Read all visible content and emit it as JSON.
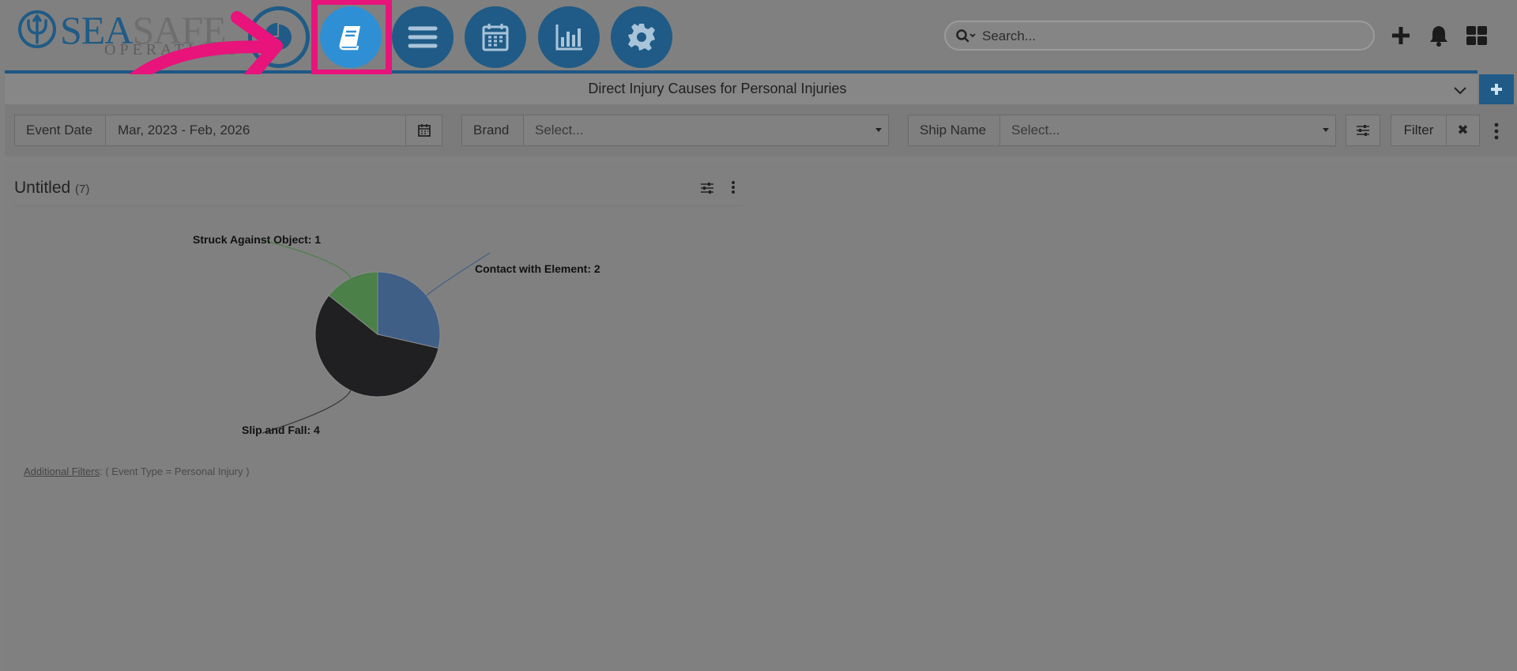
{
  "brand": {
    "logo_primary": "SEA",
    "logo_secondary": "SAFE",
    "logo_sub": "OPERATIONS",
    "accent": "#1f5b86",
    "highlight": "#e8137b"
  },
  "nav": {
    "items": [
      {
        "name": "dashboard",
        "icon": "pie-chart-icon"
      },
      {
        "name": "book",
        "icon": "book-icon",
        "active": true
      },
      {
        "name": "list",
        "icon": "list-icon"
      },
      {
        "name": "calendar",
        "icon": "calendar-icon"
      },
      {
        "name": "reports",
        "icon": "bar-chart-icon"
      },
      {
        "name": "settings",
        "icon": "gear-icon"
      }
    ]
  },
  "search": {
    "placeholder": "Search..."
  },
  "header_icons": [
    "plus-icon",
    "bell-icon",
    "grid-icon"
  ],
  "dashboard": {
    "title": "Direct Injury Causes for Personal Injuries"
  },
  "filters": {
    "event_date": {
      "label": "Event Date",
      "value": "Mar, 2023 - Feb, 2026"
    },
    "brand": {
      "label": "Brand",
      "placeholder": "Select..."
    },
    "ship_name": {
      "label": "Ship Name",
      "placeholder": "Select..."
    },
    "filter_button": "Filter",
    "clear_button": "✖"
  },
  "widget": {
    "title": "Untitled",
    "count": "(7)",
    "additional_filters_label": "Additional Filters",
    "additional_filters_value": ": ( Event Type = Personal Injury )"
  },
  "chart_data": {
    "type": "pie",
    "slices": [
      {
        "label": "Contact with Element",
        "value": 2,
        "color": "#3f5f87",
        "text": "Contact with Element: 2"
      },
      {
        "label": "Slip and Fall",
        "value": 4,
        "color": "#202022",
        "text": "Slip and Fall: 4"
      },
      {
        "label": "Struck Against Object",
        "value": 1,
        "color": "#4b8049",
        "text": "Struck Against Object: 1"
      }
    ]
  }
}
